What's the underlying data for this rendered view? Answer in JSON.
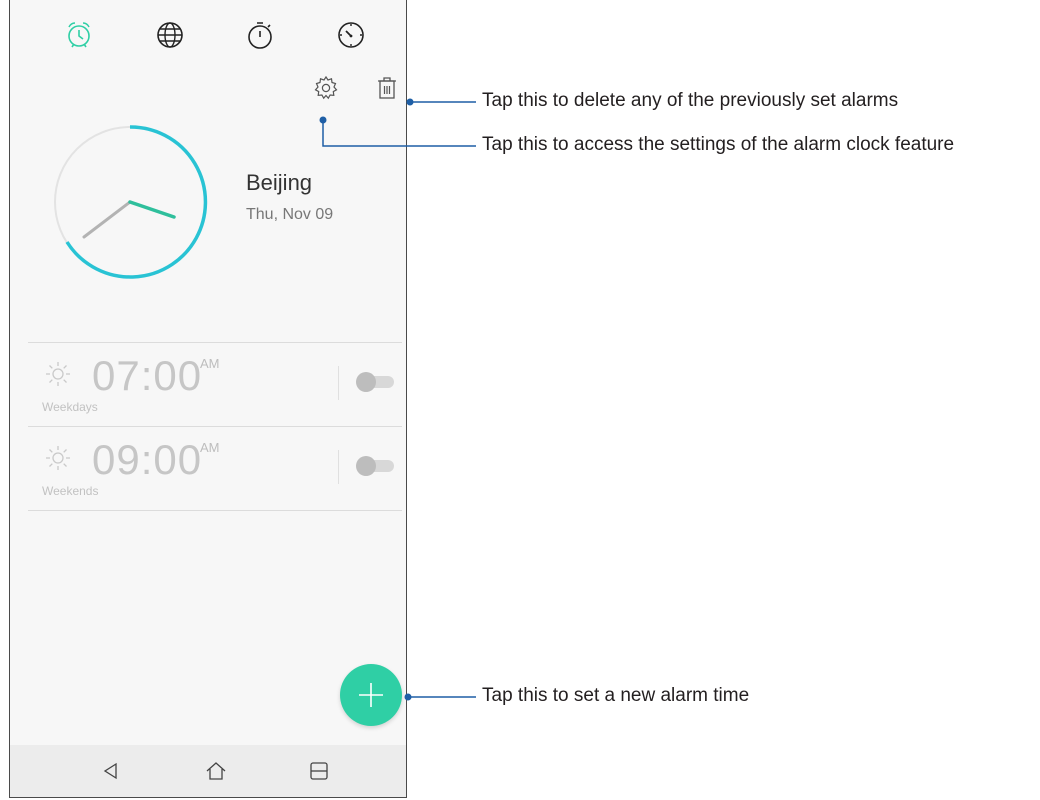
{
  "tabs": [
    {
      "icon": "alarm-clock-icon",
      "active": true
    },
    {
      "icon": "globe-icon",
      "active": false
    },
    {
      "icon": "stopwatch-icon",
      "active": false
    },
    {
      "icon": "timer-icon",
      "active": false
    }
  ],
  "toolbar": {
    "settings_icon": "gear-icon",
    "delete_icon": "trash-icon"
  },
  "clock": {
    "city": "Beijing",
    "date": "Thu, Nov 09"
  },
  "alarms": [
    {
      "time": "07:00",
      "ampm": "AM",
      "repeat": "Weekdays",
      "enabled": false
    },
    {
      "time": "09:00",
      "ampm": "AM",
      "repeat": "Weekends",
      "enabled": false
    }
  ],
  "fab_icon": "plus-icon",
  "nav": [
    "back-icon",
    "home-icon",
    "recents-icon"
  ],
  "annotations": {
    "delete": "Tap this to delete any of the previously set alarms",
    "settings": "Tap this to access the settings of the alarm clock feature",
    "add": "Tap this to set a new alarm time"
  },
  "colors": {
    "accent": "#2fcfa5",
    "ring_blue": "#29a9d6",
    "annotation_line": "#1f5fa6"
  }
}
